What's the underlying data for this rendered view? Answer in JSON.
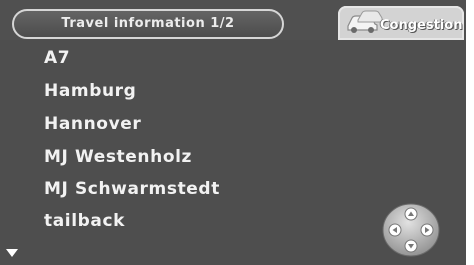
{
  "header": {
    "title": "Travel information 1/2",
    "tab_label": "Congestion",
    "tab_icon": "cars-icon"
  },
  "messages": [
    {
      "text": "A7"
    },
    {
      "text": "Hamburg"
    },
    {
      "text": "Hannover"
    },
    {
      "text": "MJ Westenholz"
    },
    {
      "text": "MJ Schwarmstedt"
    },
    {
      "text": "tailback"
    }
  ],
  "controls": {
    "scroll_indicator_icon": "triangle-down-icon",
    "navigation_pad_icon": "four-way-arrow-pad-icon"
  },
  "colors": {
    "background": "#4e4e4e",
    "text": "#f2f2f2",
    "tab_background": "#d3d3d3"
  }
}
